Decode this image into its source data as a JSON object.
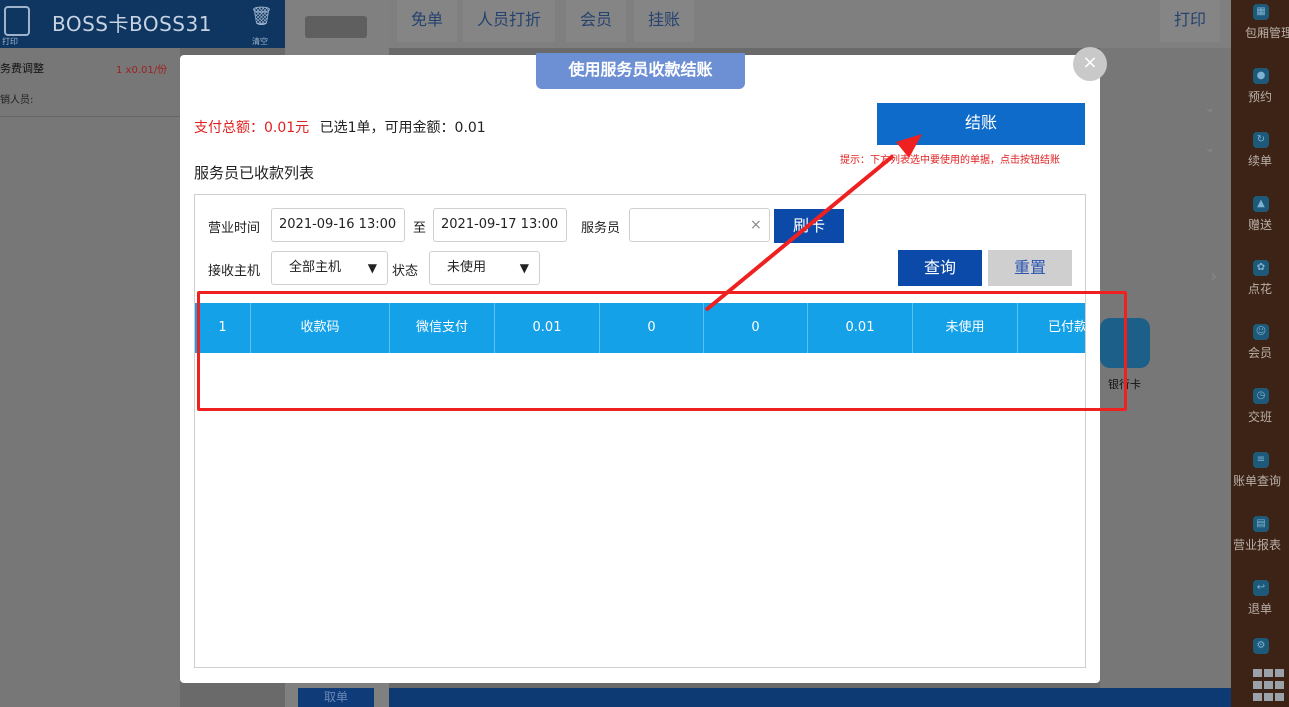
{
  "app": {
    "order_title": "BOSS卡BOSS31",
    "clear_label": "清空",
    "left_small_label": "打印",
    "items": [
      {
        "name": "务费调整",
        "qty": "1 x0.01/份"
      }
    ],
    "staff_label": "销人员:",
    "top_tabs": [
      "免单",
      "人员打折",
      "会员",
      "挂账"
    ],
    "print_label": "打印",
    "bank_card_label": "银行卡",
    "quit_label": "取单"
  },
  "sidebar": {
    "items": [
      {
        "label": "包厢管理",
        "icon": "grid-icon"
      },
      {
        "label": "预约",
        "icon": "search-icon"
      },
      {
        "label": "续单",
        "icon": "refresh-icon"
      },
      {
        "label": "赠送",
        "icon": "gift-icon"
      },
      {
        "label": "点花",
        "icon": "flower-icon"
      },
      {
        "label": "会员",
        "icon": "member-icon"
      },
      {
        "label": "交班",
        "icon": "clock-icon"
      },
      {
        "label": "账单查询",
        "icon": "bill-icon"
      },
      {
        "label": "营业报表",
        "icon": "chart-icon"
      },
      {
        "label": "退单",
        "icon": "return-icon"
      },
      {
        "label": "",
        "icon": "settings-icon"
      }
    ]
  },
  "modal": {
    "title": "使用服务员收款结账",
    "summary_total_label": "支付总额：0.01元",
    "summary_rest": "已选1单，可用金额：0.01",
    "checkout_label": "结账",
    "hint": "提示：下方列表选中要使用的单据，点击按钮结账",
    "list_title": "服务员已收款列表",
    "filters": {
      "business_time_label": "营业时间",
      "start_time": "2021-09-16 13:00",
      "to_label": "至",
      "end_time": "2021-09-17 13:00",
      "waiter_label": "服务员",
      "waiter_value": "",
      "swipe_label": "刷卡",
      "host_label": "接收主机",
      "host_value": "全部主机",
      "status_label": "状态",
      "status_value": "未使用",
      "query_label": "查询",
      "reset_label": "重置"
    },
    "rows": [
      [
        "1",
        "收款码",
        "微信支付",
        "0.01",
        "0",
        "0",
        "0.01",
        "未使用",
        "已付款"
      ]
    ]
  },
  "colors": {
    "accent": "#0f6bc9",
    "row_highlight": "#14a1e8",
    "annotation_red": "#ee2020"
  }
}
